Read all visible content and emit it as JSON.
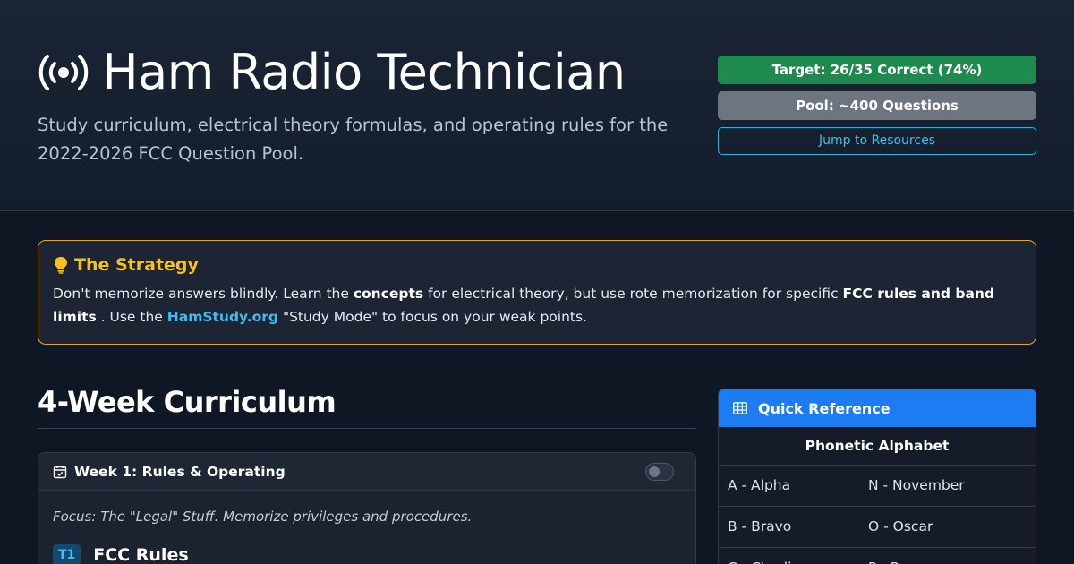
{
  "hero": {
    "icon": "broadcast-icon",
    "title": "Ham Radio Technician",
    "subtitle": "Study curriculum, electrical theory formulas, and operating rules for the 2022-2026 FCC Question Pool.",
    "badges": {
      "target": "Target: 26/35 Correct (74%)",
      "pool": "Pool: ~400 Questions",
      "jump": "Jump to Resources"
    },
    "colors": {
      "target": "#1e8a4f",
      "pool": "#6c7580",
      "link": "#39c1ef"
    }
  },
  "strategy": {
    "icon": "lightbulb-icon",
    "title": "The Strategy",
    "text": {
      "p1": "Don't memorize answers blindly. Learn the ",
      "b1": "concepts",
      "p2": " for electrical theory, but use rote memorization for specific ",
      "b2": "FCC rules and band limits",
      "p3": " . Use the ",
      "link": "HamStudy.org",
      "p4": " \"Study Mode\" to focus on your weak points."
    },
    "accent": "#f5c022"
  },
  "curriculum": {
    "title": "4-Week Curriculum",
    "week1": {
      "icon": "calendar-check-icon",
      "title": "Week 1: Rules & Operating",
      "focus": "Focus: The \"Legal\" Stuff. Memorize privileges and procedures.",
      "section_tag": "T1",
      "section_name": "FCC Rules"
    }
  },
  "quick_reference": {
    "icon": "table-icon",
    "title": "Quick Reference",
    "subtitle": "Phonetic Alphabet",
    "rows": [
      [
        "A - Alpha",
        "N - November"
      ],
      [
        "B - Bravo",
        "O - Oscar"
      ],
      [
        "C - Charlie",
        "P - Papa"
      ]
    ],
    "accent": "#1e7cf2"
  }
}
